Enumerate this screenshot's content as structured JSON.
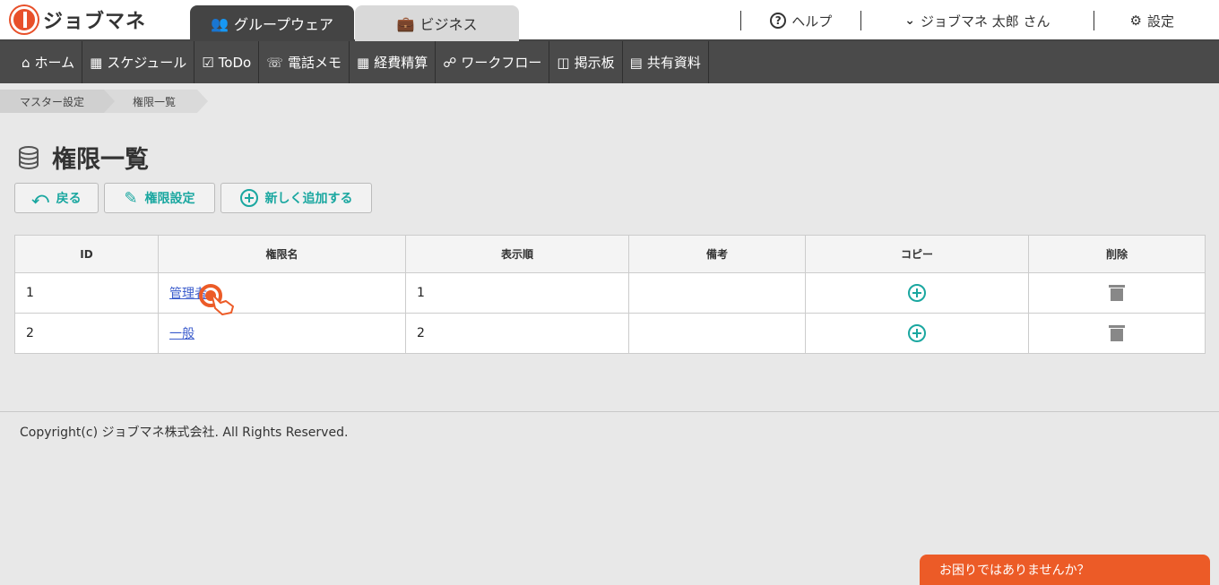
{
  "brand": {
    "name": "ジョブマネ"
  },
  "tabs": [
    {
      "label": "グループウェア",
      "active": true
    },
    {
      "label": "ビジネス",
      "active": false
    }
  ],
  "header": {
    "help": "ヘルプ",
    "user": "ジョブマネ 太郎 さん",
    "settings": "設定"
  },
  "nav": [
    {
      "label": "ホーム",
      "icon": "home-icon"
    },
    {
      "label": "スケジュール",
      "icon": "calendar-icon"
    },
    {
      "label": "ToDo",
      "icon": "clipboard-icon"
    },
    {
      "label": "電話メモ",
      "icon": "phone-icon"
    },
    {
      "label": "経費精算",
      "icon": "calculator-icon"
    },
    {
      "label": "ワークフロー",
      "icon": "workflow-icon"
    },
    {
      "label": "掲示板",
      "icon": "board-icon"
    },
    {
      "label": "共有資料",
      "icon": "documents-icon"
    }
  ],
  "breadcrumb": [
    "マスター設定",
    "権限一覧"
  ],
  "page": {
    "title": "権限一覧"
  },
  "buttons": {
    "back": "戻る",
    "perm": "権限設定",
    "add": "新しく追加する"
  },
  "table": {
    "headers": [
      "ID",
      "権限名",
      "表示順",
      "備考",
      "コピー",
      "削除"
    ],
    "rows": [
      {
        "id": "1",
        "name": "管理者",
        "order": "1",
        "note": ""
      },
      {
        "id": "2",
        "name": "一般",
        "order": "2",
        "note": ""
      }
    ]
  },
  "footer": {
    "copyright": "Copyright(c) ジョブマネ株式会社. All Rights Reserved."
  },
  "helpdesk": {
    "label": "お困りではありませんか？"
  },
  "colors": {
    "accent": "#1aa7a0",
    "brand": "#e8502a",
    "nav": "#4a4a4a",
    "helpbtn": "#ec5b27"
  }
}
